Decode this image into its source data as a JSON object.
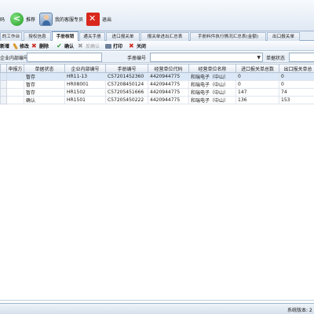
{
  "toolbar": {
    "left_label": "码",
    "recommend_label": "推荐",
    "service_label": "我的客服专员",
    "exit_label": "退出"
  },
  "tabs": [
    {
      "label": "的工作台"
    },
    {
      "label": "授权信息"
    },
    {
      "label": "手册核销"
    },
    {
      "label": "通关手册"
    },
    {
      "label": "进口报关单"
    },
    {
      "label": "报关单进出汇总表"
    },
    {
      "label": "手册料件执行情况汇总表(金额)"
    },
    {
      "label": "出口报关单"
    }
  ],
  "actions": {
    "add": "新增",
    "edit": "修改",
    "delete": "删除",
    "confirm": "确认",
    "unconfirm": "反确认",
    "print": "打印",
    "close": "关闭"
  },
  "search": {
    "internal_no_label": "企业内部编号",
    "manual_no_label": "手册编号",
    "status_label": "单据状态"
  },
  "grid": {
    "columns": [
      "申报方",
      "单据状态",
      "企业内部编号",
      "手册编号",
      "经营单位代码",
      "经营单位名称",
      "进口报关单总数",
      "出口报关单总"
    ],
    "rows": [
      [
        "",
        "暂存",
        "HR11-13",
        "C57201452360",
        "4420944775",
        "和瑞电子（中山）",
        "0",
        "0"
      ],
      [
        "",
        "暂存",
        "HR08001",
        "C57208450124",
        "4420944775",
        "和瑞电子（中山）",
        "0",
        "0"
      ],
      [
        "",
        "暂存",
        "HR1502",
        "C57205451666",
        "4420944775",
        "和瑞电子（中山）",
        "147",
        "74"
      ],
      [
        "",
        "确认",
        "HR1501",
        "C57205450222",
        "4420944775",
        "和瑞电子（中山）",
        "136",
        "153"
      ]
    ]
  },
  "status": {
    "text": "系统版本: 2"
  }
}
